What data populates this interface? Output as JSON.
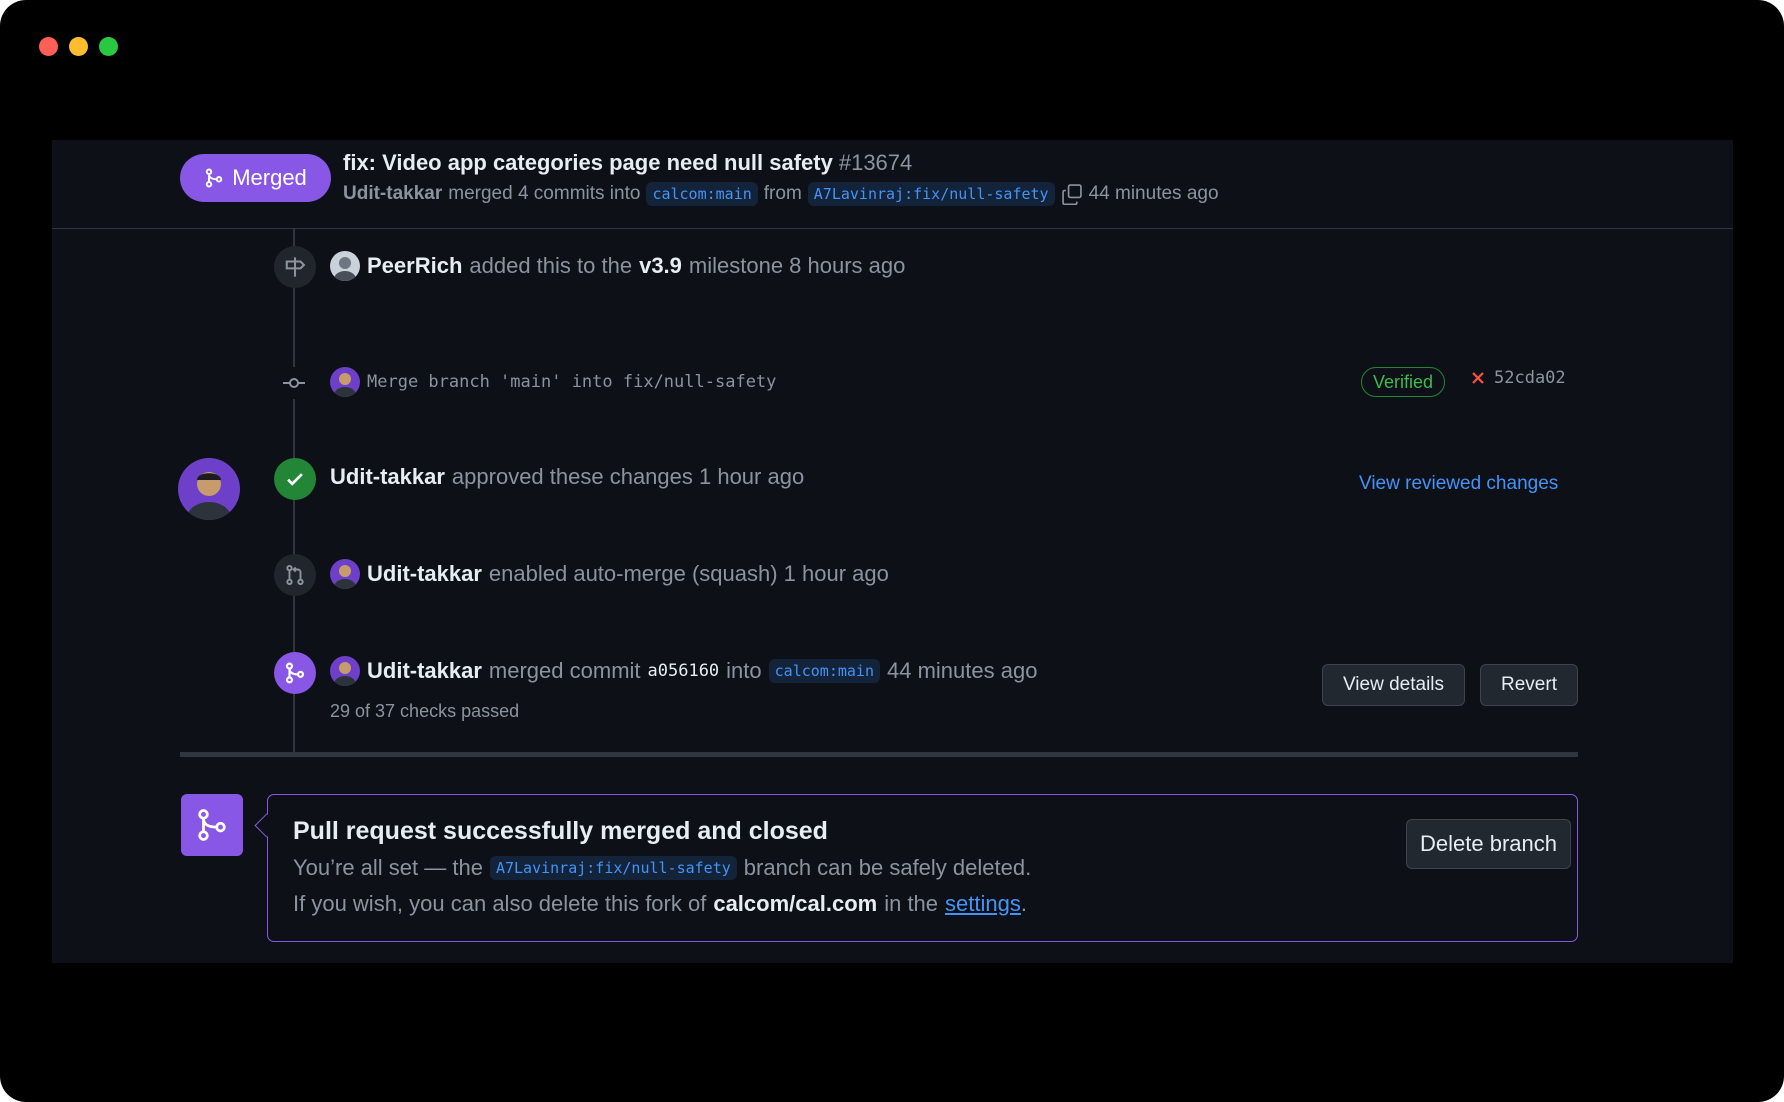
{
  "pr": {
    "status": "Merged",
    "title": "fix: Video app categories page need null safety",
    "number": "#13674",
    "author": "Udit-takkar",
    "merged_text": "merged 4 commits into",
    "base_branch": "calcom:main",
    "from_text": "from",
    "head_branch": "A7Lavinraj:fix/null-safety",
    "time": "44 minutes ago"
  },
  "timeline": {
    "milestone": {
      "user": "PeerRich",
      "text_before": "added this to the",
      "milestone": "v3.9",
      "text_after": "milestone 8 hours ago"
    },
    "commit": {
      "message": "Merge branch 'main' into fix/null-safety",
      "verified": "Verified",
      "sha": "52cda02"
    },
    "review": {
      "user": "Udit-takkar",
      "text": "approved these changes 1 hour ago",
      "link": "View reviewed changes"
    },
    "automerge": {
      "user": "Udit-takkar",
      "text": "enabled auto-merge (squash) 1 hour ago"
    },
    "merge": {
      "user": "Udit-takkar",
      "text_before": "merged commit",
      "sha": "a056160",
      "text_into": "into",
      "branch": "calcom:main",
      "time": "44 minutes ago",
      "checks": "29 of 37 checks passed",
      "view_details": "View details",
      "revert": "Revert"
    }
  },
  "merge_box": {
    "title": "Pull request successfully merged and closed",
    "line1_before": "You’re all set — the",
    "branch": "A7Lavinraj:fix/null-safety",
    "line1_after": "branch can be safely deleted.",
    "line2_before": "If you wish, you can also delete this fork of",
    "repo": "calcom/cal.com",
    "line2_middle": "in the",
    "settings_link": "settings",
    "line2_after": ".",
    "delete_button": "Delete branch"
  },
  "colors": {
    "background": "#0d1117",
    "merged_purple": "#8957e5",
    "approved_green": "#238636",
    "link_blue": "#4493f8",
    "verified_green": "#3fb950",
    "fail_red": "#f85149"
  },
  "icons": [
    "merge-icon",
    "copy-icon",
    "milestone-icon",
    "commit-icon",
    "check-icon",
    "auto-merge-icon",
    "x-icon"
  ]
}
